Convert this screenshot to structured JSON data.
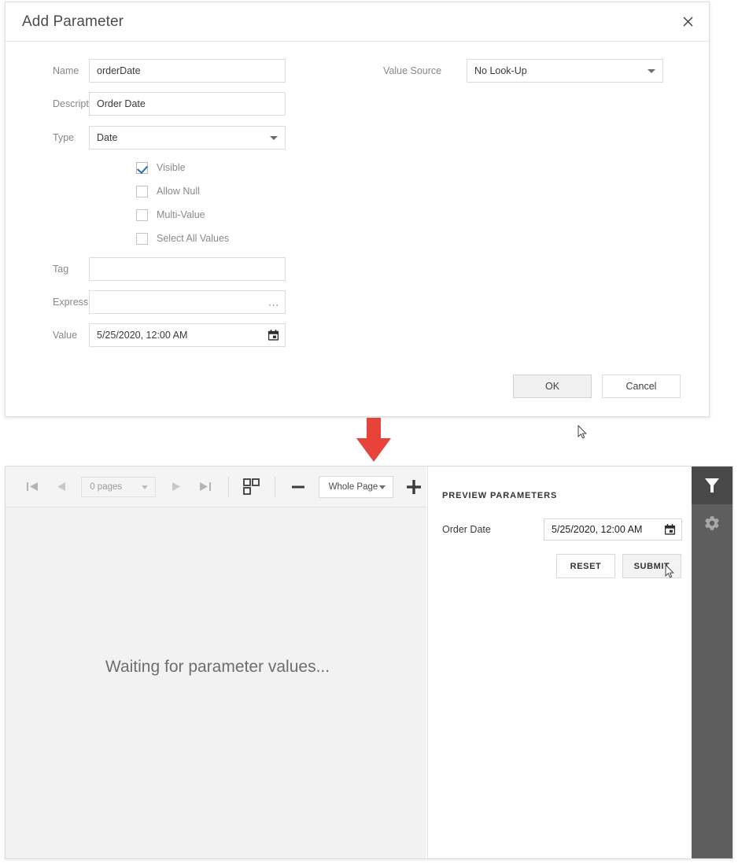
{
  "dialog": {
    "title": "Add Parameter",
    "close_icon": "close-icon",
    "fields": {
      "name_label": "Name",
      "name_value": "orderDate",
      "description_label": "Description",
      "description_value": "Order Date",
      "type_label": "Type",
      "type_value": "Date",
      "tag_label": "Tag",
      "tag_value": "",
      "expression_label": "Expression",
      "expression_value": "",
      "expression_ellipsis": "...",
      "value_label": "Value",
      "value_value": "5/25/2020, 12:00 AM",
      "value_source_label": "Value Source",
      "value_source_value": "No Look-Up"
    },
    "checkboxes": [
      {
        "label": "Visible",
        "checked": true
      },
      {
        "label": "Allow Null",
        "checked": false
      },
      {
        "label": "Multi-Value",
        "checked": false
      },
      {
        "label": "Select All Values",
        "checked": false
      }
    ],
    "ok_label": "OK",
    "cancel_label": "Cancel"
  },
  "annotation": {
    "arrow_color": "#e8433a",
    "arrow_direction": "down"
  },
  "viewer": {
    "toolbar": {
      "first_page_icon": "first-page-icon",
      "prev_page_icon": "previous-page-icon",
      "pages_value": "0 pages",
      "next_page_icon": "next-page-icon",
      "last_page_icon": "last-page-icon",
      "multipage_icon": "multipage-view-icon",
      "zoom_out_icon": "zoom-out-icon",
      "zoom_value": "Whole Page",
      "zoom_in_icon": "zoom-in-icon"
    },
    "canvas_message": "Waiting for parameter values...",
    "parameters_panel": {
      "title": "PREVIEW PARAMETERS",
      "param_label": "Order Date",
      "param_value": "5/25/2020, 12:00 AM",
      "calendar_icon": "calendar-icon",
      "reset_label": "RESET",
      "submit_label": "SUBMIT"
    },
    "right_rail": {
      "filter_icon": "filter-icon",
      "settings_icon": "gear-icon",
      "collapse_icon": "chevron-right-icon",
      "background_color": "#5e5e5e",
      "active_background_color": "#484848"
    }
  }
}
